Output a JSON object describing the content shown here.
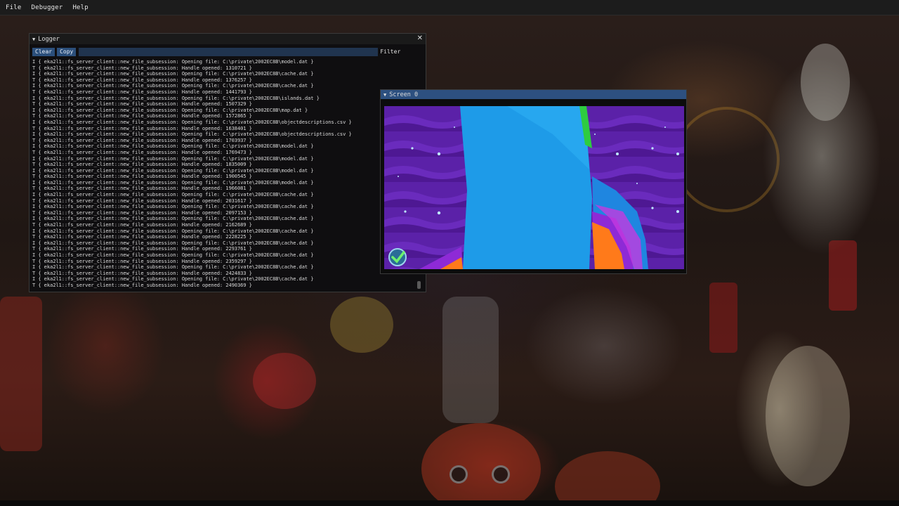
{
  "menubar": {
    "items": [
      "File",
      "Debugger",
      "Help"
    ]
  },
  "logger": {
    "title": "Logger",
    "clear_label": "Clear",
    "copy_label": "Copy",
    "filter_label": "Filter",
    "filter_value": "",
    "lines": [
      "I { eka2l1::fs_server_client::new_file_subsession: Opening file: C:\\private\\2002EC8B\\model.dat }",
      "T { eka2l1::fs_server_client::new_file_subsession: Handle opened: 1310721 }",
      "I { eka2l1::fs_server_client::new_file_subsession: Opening file: C:\\private\\2002EC8B\\cache.dat }",
      "T { eka2l1::fs_server_client::new_file_subsession: Handle opened: 1376257 }",
      "I { eka2l1::fs_server_client::new_file_subsession: Opening file: C:\\private\\2002EC8B\\cache.dat }",
      "T { eka2l1::fs_server_client::new_file_subsession: Handle opened: 1441793 }",
      "I { eka2l1::fs_server_client::new_file_subsession: Opening file: C:\\private\\2002EC8B\\islands.dat }",
      "T { eka2l1::fs_server_client::new_file_subsession: Handle opened: 1507329 }",
      "I { eka2l1::fs_server_client::new_file_subsession: Opening file: C:\\private\\2002EC8B\\map.dat }",
      "T { eka2l1::fs_server_client::new_file_subsession: Handle opened: 1572865 }",
      "I { eka2l1::fs_server_client::new_file_subsession: Opening file: C:\\private\\2002EC8B\\objectdescriptions.csv }",
      "T { eka2l1::fs_server_client::new_file_subsession: Handle opened: 1638401 }",
      "I { eka2l1::fs_server_client::new_file_subsession: Opening file: C:\\private\\2002EC8B\\objectdescriptions.csv }",
      "T { eka2l1::fs_server_client::new_file_subsession: Handle opened: 1703937 }",
      "I { eka2l1::fs_server_client::new_file_subsession: Opening file: C:\\private\\2002EC8B\\model.dat }",
      "T { eka2l1::fs_server_client::new_file_subsession: Handle opened: 1769473 }",
      "I { eka2l1::fs_server_client::new_file_subsession: Opening file: C:\\private\\2002EC8B\\model.dat }",
      "T { eka2l1::fs_server_client::new_file_subsession: Handle opened: 1835009 }",
      "I { eka2l1::fs_server_client::new_file_subsession: Opening file: C:\\private\\2002EC8B\\model.dat }",
      "T { eka2l1::fs_server_client::new_file_subsession: Handle opened: 1900545 }",
      "I { eka2l1::fs_server_client::new_file_subsession: Opening file: C:\\private\\2002EC8B\\model.dat }",
      "T { eka2l1::fs_server_client::new_file_subsession: Handle opened: 1966081 }",
      "I { eka2l1::fs_server_client::new_file_subsession: Opening file: C:\\private\\2002EC8B\\cache.dat }",
      "T { eka2l1::fs_server_client::new_file_subsession: Handle opened: 2031617 }",
      "I { eka2l1::fs_server_client::new_file_subsession: Opening file: C:\\private\\2002EC8B\\cache.dat }",
      "T { eka2l1::fs_server_client::new_file_subsession: Handle opened: 2097153 }",
      "I { eka2l1::fs_server_client::new_file_subsession: Opening file: C:\\private\\2002EC8B\\cache.dat }",
      "T { eka2l1::fs_server_client::new_file_subsession: Handle opened: 2162689 }",
      "I { eka2l1::fs_server_client::new_file_subsession: Opening file: C:\\private\\2002EC8B\\cache.dat }",
      "T { eka2l1::fs_server_client::new_file_subsession: Handle opened: 2228225 }",
      "I { eka2l1::fs_server_client::new_file_subsession: Opening file: C:\\private\\2002EC8B\\cache.dat }",
      "T { eka2l1::fs_server_client::new_file_subsession: Handle opened: 2293761 }",
      "I { eka2l1::fs_server_client::new_file_subsession: Opening file: C:\\private\\2002EC8B\\cache.dat }",
      "T { eka2l1::fs_server_client::new_file_subsession: Handle opened: 2359297 }",
      "I { eka2l1::fs_server_client::new_file_subsession: Opening file: C:\\private\\2002EC8B\\cache.dat }",
      "T { eka2l1::fs_server_client::new_file_subsession: Handle opened: 2424833 }",
      "I { eka2l1::fs_server_client::new_file_subsession: Opening file: C:\\private\\2002EC8B\\cache.dat }",
      "T { eka2l1::fs_server_client::new_file_subsession: Handle opened: 2490369 }"
    ]
  },
  "screen": {
    "title": "Screen 0"
  },
  "icons": {
    "collapse": "triangle-down-icon",
    "close": "close-icon",
    "checkmark": "checkmark-icon",
    "cursor": "mouse-cursor-icon"
  },
  "colors": {
    "menubar_bg": "#1c1c1c",
    "button_bg": "#2b4f7b",
    "title_active": "#2d5080",
    "game_sky": "#5a1fa5",
    "game_wall": "#1e9be8"
  }
}
